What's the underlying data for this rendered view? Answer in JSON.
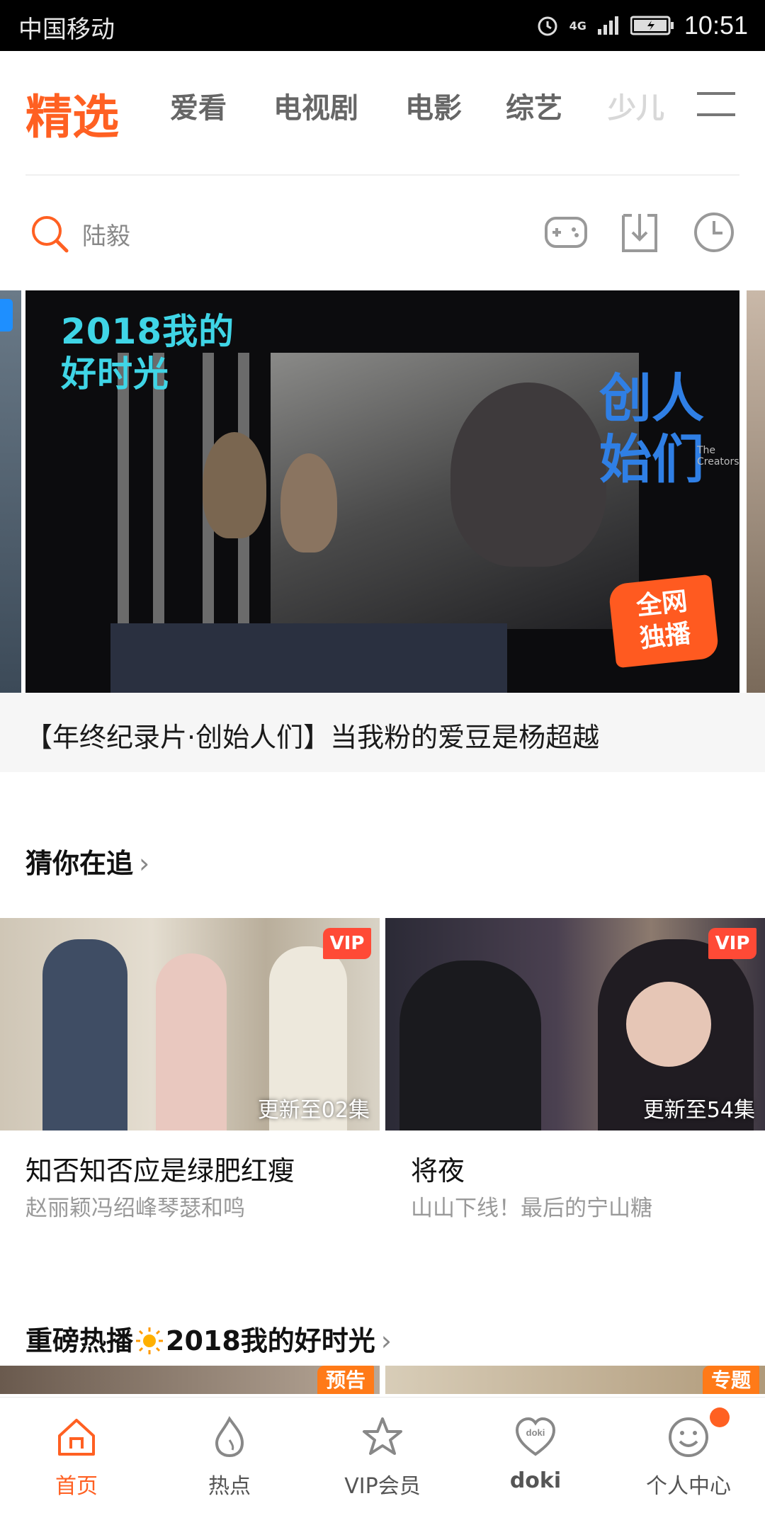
{
  "status_bar": {
    "carrier": "中国移动",
    "network": "4G",
    "time": "10:51"
  },
  "tabs": {
    "items": [
      {
        "label": "精选"
      },
      {
        "label": "爱看"
      },
      {
        "label": "电视剧"
      },
      {
        "label": "电影"
      },
      {
        "label": "综艺"
      },
      {
        "label": "少儿"
      }
    ]
  },
  "search": {
    "placeholder": "陆毅"
  },
  "banner": {
    "logo_line1": "2018我的",
    "logo_line2": "好时光",
    "show_title_vertical": "创人始们",
    "show_subtitle": "The Creators",
    "badge_line1": "全网",
    "badge_line2": "独播",
    "caption": "【年终纪录片·创始人们】当我粉的爱豆是杨超越"
  },
  "section1": {
    "title": "猜你在追",
    "chevron": "›",
    "cards": [
      {
        "vip": "VIP",
        "update": "更新至02集",
        "title": "知否知否应是绿肥红瘦",
        "subtitle": "赵丽颖冯绍峰琴瑟和鸣"
      },
      {
        "vip": "VIP",
        "update": "更新至54集",
        "title": "将夜",
        "subtitle": "山山下线！最后的宁山糖"
      }
    ]
  },
  "section2": {
    "title": "重磅热播",
    "title_suffix": "2018我的好时光",
    "chevron": "›",
    "cards": [
      {
        "tag": "预告"
      },
      {
        "tag": "专题"
      }
    ]
  },
  "bottom_nav": {
    "items": [
      {
        "label": "首页"
      },
      {
        "label": "热点"
      },
      {
        "label": "VIP会员"
      },
      {
        "label": "doki"
      },
      {
        "label": "个人中心"
      }
    ]
  },
  "colors": {
    "accent": "#ff6022",
    "vip_red": "#ff4a36",
    "banner_title_cyan": "#3fd5e6",
    "banner_title_blue": "#2f7fe5"
  },
  "icons": [
    "search-icon",
    "gamepad-icon",
    "download-icon",
    "history-icon",
    "menu-icon",
    "home-icon",
    "flame-icon",
    "vip-star-icon",
    "doki-heart-icon",
    "smiley-icon"
  ]
}
